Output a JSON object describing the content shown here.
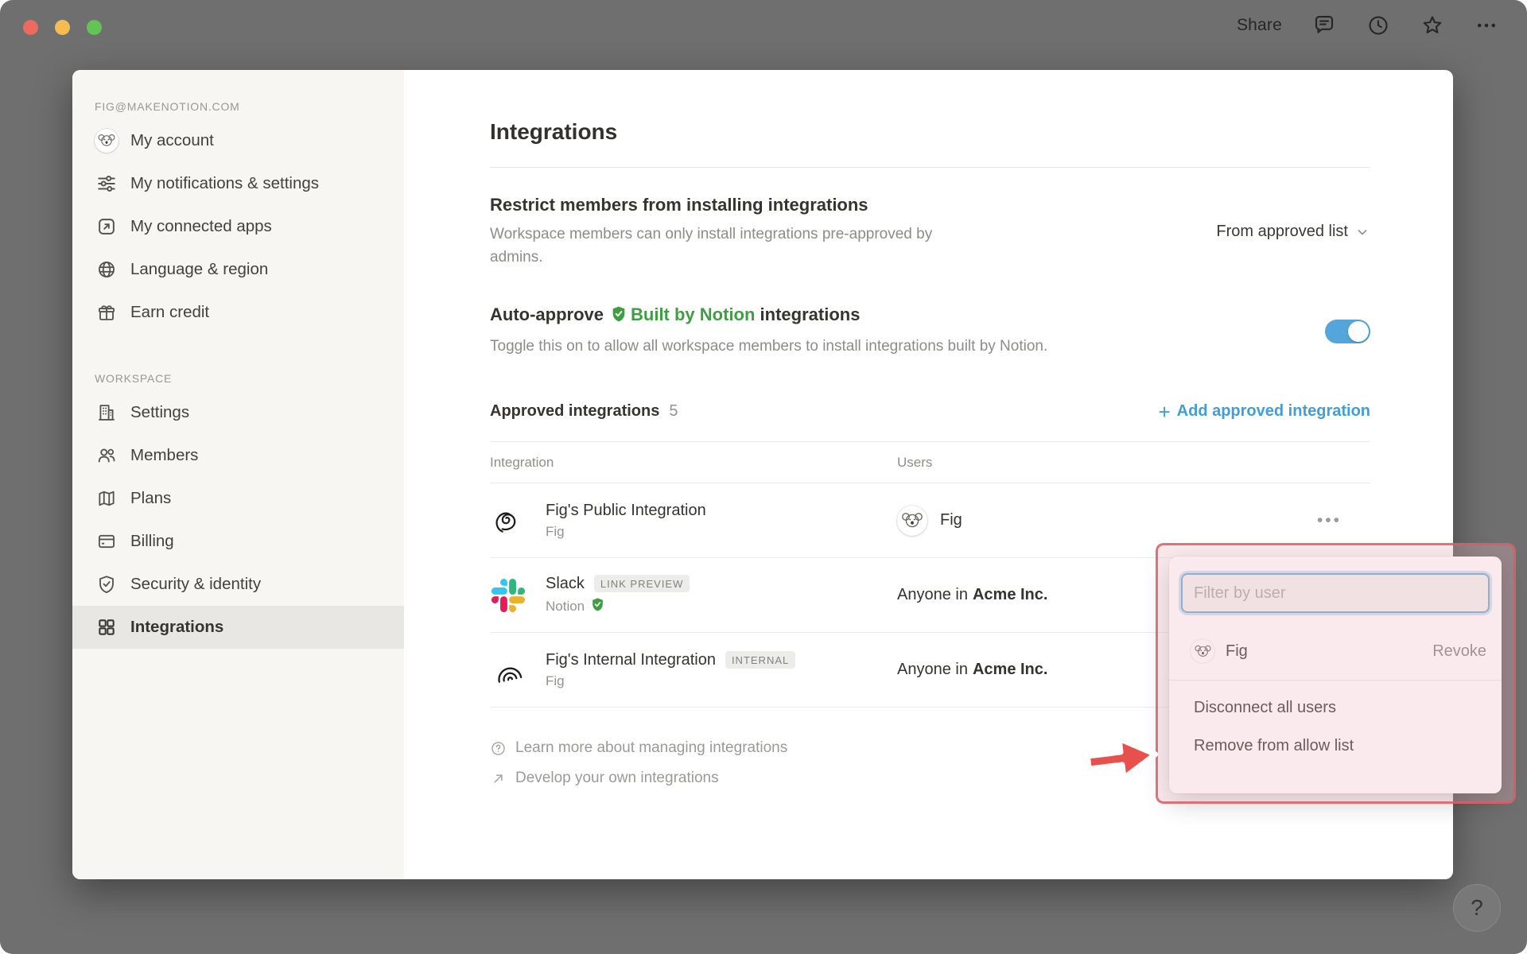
{
  "topbar": {
    "share_label": "Share",
    "icons": [
      "comments-icon",
      "history-clock-icon",
      "star-icon",
      "more-icon"
    ]
  },
  "icons": {
    "more": "•••",
    "plus": "+",
    "chevron_down": "▾",
    "question": "?"
  },
  "sidebar": {
    "account_header": "FIG@MAKENOTION.COM",
    "account_items": [
      {
        "label": "My account",
        "icon": "koala-avatar"
      },
      {
        "label": "My notifications & settings",
        "icon": "sliders"
      },
      {
        "label": "My connected apps",
        "icon": "arrow-out-box"
      },
      {
        "label": "Language & region",
        "icon": "globe"
      },
      {
        "label": "Earn credit",
        "icon": "gift"
      }
    ],
    "workspace_header": "WORKSPACE",
    "workspace_items": [
      {
        "label": "Settings",
        "icon": "building"
      },
      {
        "label": "Members",
        "icon": "people"
      },
      {
        "label": "Plans",
        "icon": "map"
      },
      {
        "label": "Billing",
        "icon": "credit-card"
      },
      {
        "label": "Security & identity",
        "icon": "shield-check"
      },
      {
        "label": "Integrations",
        "icon": "grid",
        "active": true
      }
    ]
  },
  "main": {
    "title": "Integrations",
    "restrict": {
      "heading": "Restrict members from installing integrations",
      "description": "Workspace members can only install integrations pre-approved by admins.",
      "dropdown_value": "From approved list"
    },
    "auto_approve": {
      "prefix": "Auto-approve",
      "badge": "Built by Notion",
      "suffix": "integrations",
      "description": "Toggle this on to allow all workspace members to install integrations built by Notion.",
      "enabled": true
    },
    "approved": {
      "heading": "Approved integrations",
      "count": "5",
      "add_label": "Add approved integration"
    },
    "table": {
      "headers": {
        "integration": "Integration",
        "users": "Users"
      },
      "rows": [
        {
          "name": "Fig's Public Integration",
          "sub": "Fig",
          "user": "Fig"
        },
        {
          "name": "Slack",
          "badge": "LINK PREVIEW",
          "sub": "Notion",
          "verified": true,
          "users_prefix": "Anyone in",
          "users_org": "Acme Inc."
        },
        {
          "name": "Fig's Internal Integration",
          "badge": "INTERNAL",
          "sub": "Fig",
          "users_prefix": "Anyone in",
          "users_org": "Acme Inc."
        }
      ]
    },
    "footer_links": [
      {
        "label": "Learn more about managing integrations",
        "icon": "question-circle"
      },
      {
        "label": "Develop your own integrations",
        "icon": "arrow-ne"
      }
    ]
  },
  "popup": {
    "filter_placeholder": "Filter by user",
    "user_row": {
      "name": "Fig",
      "action": "Revoke"
    },
    "menu_items": [
      {
        "label": "Disconnect all users"
      },
      {
        "label": "Remove from allow list"
      }
    ]
  },
  "help_label": "?",
  "colors": {
    "accent_blue": "#3f9edb",
    "toggle_blue": "#54a5da",
    "verified_green": "#3f9e43",
    "arrow_red": "#e8504d",
    "annotation_border": "#db5c61",
    "sidebar_bg": "#f7f6f3",
    "surround_gray": "#6f6f6f"
  }
}
